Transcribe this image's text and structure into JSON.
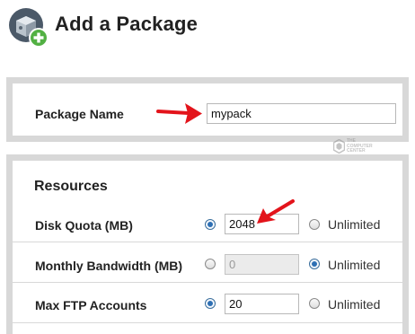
{
  "header": {
    "title": "Add a Package",
    "icon": "package-add-icon"
  },
  "package_section": {
    "name_label": "Package Name",
    "name_value": "mypack"
  },
  "resources": {
    "title": "Resources",
    "rows": [
      {
        "label": "Disk Quota (MB)",
        "value": "2048",
        "selected": "value",
        "unlimited_label": "Unlimited"
      },
      {
        "label": "Monthly Bandwidth (MB)",
        "value": "0",
        "selected": "unlimited",
        "unlimited_label": "Unlimited"
      },
      {
        "label": "Max FTP Accounts",
        "value": "20",
        "selected": "value",
        "unlimited_label": "Unlimited"
      }
    ]
  },
  "watermark": {
    "lines": [
      "THE",
      "COMPUTER",
      "CENTER"
    ]
  },
  "colors": {
    "annotation_arrow": "#e3141b",
    "radio_accent": "#2d6fb4",
    "panel_border": "#d8d8d8"
  }
}
